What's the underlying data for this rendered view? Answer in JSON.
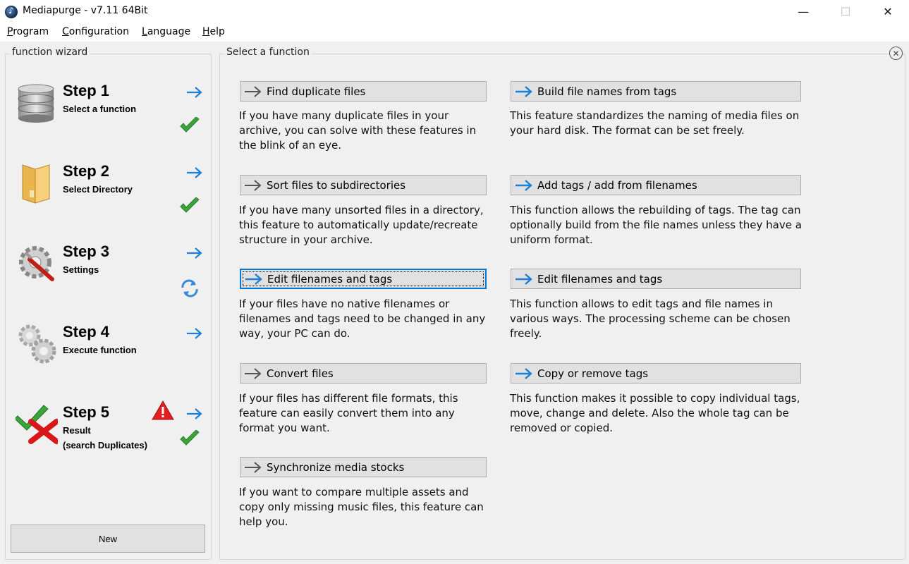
{
  "window": {
    "title": "Mediapurge - v7.11 64Bit",
    "controls": {
      "minimize": "—",
      "maximize": "☐",
      "close": "✕"
    }
  },
  "menu": [
    {
      "label": "Program",
      "underline": "P",
      "rest": "rogram"
    },
    {
      "label": "Configuration",
      "underline": "C",
      "rest": "onfiguration"
    },
    {
      "label": "Language",
      "underline": "L",
      "rest": "anguage"
    },
    {
      "label": "Help",
      "underline": "H",
      "rest": "elp"
    }
  ],
  "wizard": {
    "title": "function wizard",
    "steps": [
      {
        "title": "Step 1",
        "subtitle": "Select a function",
        "icon": "database-icon",
        "status": "done"
      },
      {
        "title": "Step 2",
        "subtitle": "Select Directory",
        "icon": "folder-icon",
        "status": "done"
      },
      {
        "title": "Step 3",
        "subtitle": "Settings",
        "icon": "settings-gear-icon",
        "status": "refresh"
      },
      {
        "title": "Step 4",
        "subtitle": "Execute function",
        "icon": "gears-icon",
        "status": "none"
      },
      {
        "title": "Step 5",
        "subtitle_line1": "Result",
        "subtitle_line2": "(search Duplicates)",
        "icon": "result-icon",
        "status": "done",
        "warning": true
      }
    ],
    "new_button": "New"
  },
  "main": {
    "title": "Select a function",
    "functions": [
      {
        "label": "Find duplicate files",
        "arrow": "gray",
        "desc": [
          "If you have many duplicate files in your",
          "archive, you can solve with these features in",
          "the blink of an eye."
        ]
      },
      {
        "label": "Build file names from tags",
        "arrow": "blue",
        "desc": [
          "This feature standardizes the naming of media files on",
          "your hard disk. The format can be set freely."
        ]
      },
      {
        "label": "Sort files to subdirectories",
        "arrow": "gray",
        "desc": [
          "If you have many unsorted files in a directory,",
          "this feature to automatically update/recreate",
          "structure in your archive."
        ]
      },
      {
        "label": "Add tags / add from filenames",
        "arrow": "blue",
        "desc": [
          "This function allows the rebuilding of tags. The tag can",
          "optionally build from the file names unless they have a",
          "uniform format."
        ]
      },
      {
        "label": "Edit filenames and tags",
        "arrow": "blue",
        "focused": true,
        "desc": [
          "If your files have no native filenames or",
          "filenames and tags need to be changed in any",
          "way, your PC can do."
        ]
      },
      {
        "label": "Edit filenames and tags",
        "arrow": "blue",
        "desc": [
          "This function allows to edit tags and file names in",
          "various ways. The processing scheme can be chosen",
          "freely."
        ]
      },
      {
        "label": "Convert files",
        "arrow": "gray",
        "desc": [
          "If your files has different file formats, this",
          "feature can easily convert them into any",
          "format you want."
        ]
      },
      {
        "label": "Copy or remove tags",
        "arrow": "blue",
        "desc": [
          "This function makes it possible to copy individual tags,",
          "move, change and delete. Also the whole tag can be",
          "removed or copied."
        ]
      },
      {
        "label": "Synchronize media stocks",
        "arrow": "gray",
        "desc": [
          "If you want to compare multiple assets and",
          "copy only missing music files, this feature can",
          "help you."
        ]
      }
    ]
  },
  "colors": {
    "accent_blue": "#1e7fd6",
    "check_green": "#3aa63a",
    "warning_red": "#e02020"
  }
}
